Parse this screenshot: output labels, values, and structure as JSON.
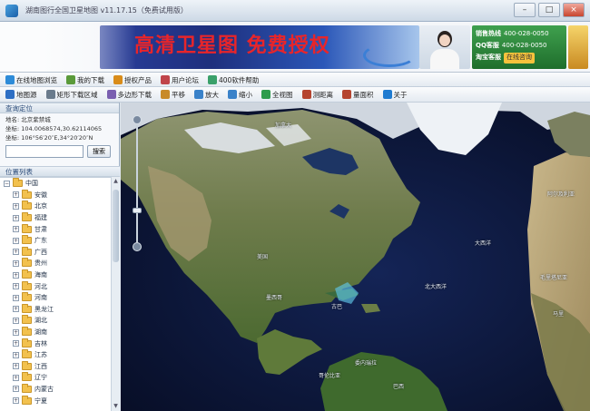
{
  "window": {
    "title": "湖南图行全国卫星地图 v11.17.15（免费试用版）",
    "buttons": {
      "minimize": "–",
      "maximize": "□",
      "close": "×"
    }
  },
  "banner": {
    "slogan": "高清卫星图 免费授权",
    "contacts": [
      {
        "label": "销售热线",
        "value": "400-028-0050"
      },
      {
        "label": "QQ客服",
        "value": "400-028-0050"
      },
      {
        "label": "淘宝客服",
        "value": "在线咨询"
      }
    ]
  },
  "toolbar1": {
    "items": [
      {
        "icon": "globe-icon",
        "label": "在线地图浏览",
        "color": "#2d8bd8"
      },
      {
        "icon": "download-icon",
        "label": "我的下载",
        "color": "#5a9a3a"
      },
      {
        "icon": "cart-icon",
        "label": "授权产品",
        "color": "#d98c1a"
      },
      {
        "icon": "forum-icon",
        "label": "用户论坛",
        "color": "#c0444a"
      },
      {
        "icon": "help-icon",
        "label": "400软件帮助",
        "color": "#3aa06a"
      }
    ]
  },
  "toolbar2": {
    "items": [
      {
        "icon": "layers-icon",
        "label": "地图源",
        "color": "#2e6fc4"
      },
      {
        "icon": "rect-select-icon",
        "label": "矩形下载区域",
        "color": "#6a7b8c"
      },
      {
        "icon": "polygon-icon",
        "label": "多边形下载",
        "color": "#7a5fb0"
      },
      {
        "icon": "hand-icon",
        "label": "平移",
        "color": "#c88a2a"
      },
      {
        "icon": "zoom-in-icon",
        "label": "放大",
        "color": "#3a82c9"
      },
      {
        "icon": "zoom-out-icon",
        "label": "缩小",
        "color": "#3a82c9"
      },
      {
        "icon": "full-extent-icon",
        "label": "全视图",
        "color": "#2f9c4c"
      },
      {
        "icon": "measure-icon",
        "label": "测距离",
        "color": "#b5452f"
      },
      {
        "icon": "area-icon",
        "label": "量面积",
        "color": "#b5452f"
      },
      {
        "icon": "info-icon",
        "label": "关于",
        "color": "#1f7bd0"
      }
    ]
  },
  "left_panel": {
    "location_header": "查询定位",
    "location_lines": [
      "地名: 北京紫禁城",
      "坐标: 104.0068574,30.62114065",
      "坐标: 106°56′20″E,34°20′20″N"
    ],
    "search": {
      "placeholder": "",
      "button": "搜索"
    },
    "tree_header": "位置列表",
    "tree": [
      {
        "label": "中国",
        "expander": "−"
      },
      {
        "label": "安徽",
        "expander": "+"
      },
      {
        "label": "北京",
        "expander": "+"
      },
      {
        "label": "福建",
        "expander": "+"
      },
      {
        "label": "甘肃",
        "expander": "+"
      },
      {
        "label": "广东",
        "expander": "+"
      },
      {
        "label": "广西",
        "expander": "+"
      },
      {
        "label": "贵州",
        "expander": "+"
      },
      {
        "label": "海南",
        "expander": "+"
      },
      {
        "label": "河北",
        "expander": "+"
      },
      {
        "label": "河南",
        "expander": "+"
      },
      {
        "label": "黑龙江",
        "expander": "+"
      },
      {
        "label": "湖北",
        "expander": "+"
      },
      {
        "label": "湖南",
        "expander": "+"
      },
      {
        "label": "吉林",
        "expander": "+"
      },
      {
        "label": "江苏",
        "expander": "+"
      },
      {
        "label": "江西",
        "expander": "+"
      },
      {
        "label": "辽宁",
        "expander": "+"
      },
      {
        "label": "内蒙古",
        "expander": "+"
      },
      {
        "label": "宁夏",
        "expander": "+"
      }
    ]
  },
  "map": {
    "labels": [
      "美国",
      "墨西哥",
      "北大西洋",
      "大西洋",
      "巴西",
      "委内瑞拉",
      "哥伦比亚",
      "加拿大",
      "古巴",
      "毛里塔尼亚",
      "马里",
      "阿尔及利亚"
    ]
  }
}
